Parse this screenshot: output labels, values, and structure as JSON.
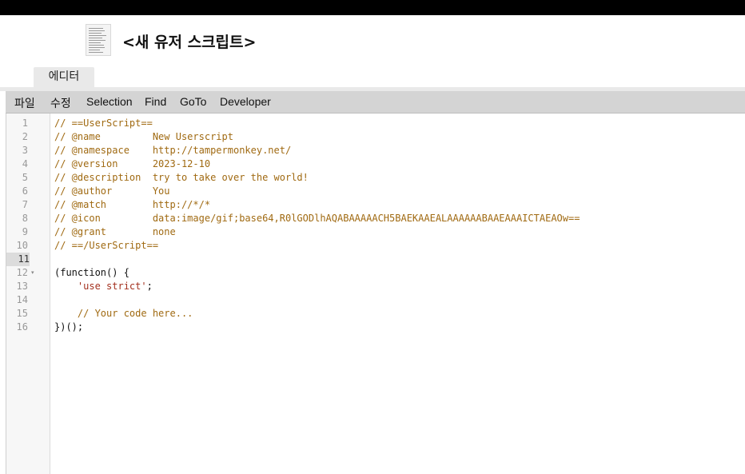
{
  "header": {
    "title": "<새 유저 스크립트>",
    "icon": "script-file-icon"
  },
  "tabs": [
    {
      "label": "에디터",
      "active": true
    }
  ],
  "menu": {
    "items": [
      "파일",
      "수정",
      "Selection",
      "Find",
      "GoTo",
      "Developer"
    ]
  },
  "editor": {
    "active_line": 11,
    "fold_marker_line": 12,
    "line_numbers": [
      "1",
      "2",
      "3",
      "4",
      "5",
      "6",
      "7",
      "8",
      "9",
      "10",
      "11",
      "12",
      "13",
      "14",
      "15",
      "16"
    ],
    "lines": [
      "// ==UserScript==",
      "// @name         New Userscript",
      "// @namespace    http://tampermonkey.net/",
      "// @version      2023-12-10",
      "// @description  try to take over the world!",
      "// @author       You",
      "// @match        http://*/*",
      "// @icon         data:image/gif;base64,R0lGODlhAQABAAAAACH5BAEKAAEALAAAAAABAAEAAAICTAEAOw==",
      "// @grant        none",
      "// ==/UserScript==",
      "",
      "(function() {",
      "    'use strict';",
      "",
      "    // Your code here...",
      "})();"
    ]
  },
  "colors": {
    "comment": "#a06a12",
    "string": "#a3301e",
    "menubar": "#d4d4d4",
    "tab": "#e9e9e9"
  }
}
